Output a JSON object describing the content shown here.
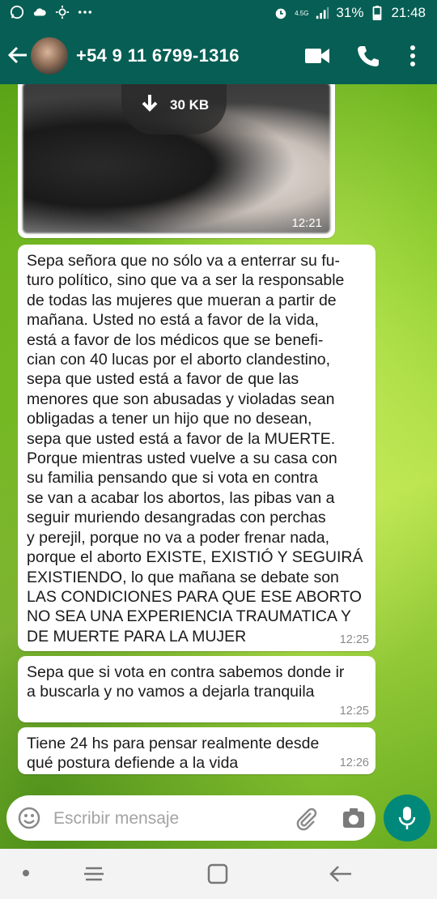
{
  "status_bar": {
    "network_label": "4.5G",
    "battery": "31%",
    "time": "21:48",
    "icons": [
      "whatsapp-icon",
      "cloud-icon",
      "weather-icon",
      "more-dots-icon",
      "alarm-icon",
      "signal-icon",
      "battery-icon"
    ]
  },
  "header": {
    "contact_name": "+54 9 11 6799-1316",
    "colors": {
      "bar": "#075e54"
    }
  },
  "messages": [
    {
      "type": "image",
      "download_size": "30 KB",
      "time": "12:21"
    },
    {
      "type": "text",
      "text": "Sepa señora que no sólo va a enterrar su fu-\nturo político, sino que va a ser la responsable\nde todas las mujeres que mueran a partir de\nmañana. Usted no está a favor de la vida,\nestá a favor de los médicos que se benefi-\ncian con 40 lucas por el aborto clandestino,\nsepa que usted está a favor de que las\nmenores que son abusadas y violadas sean\nobligadas a tener un hijo que no desean,\nsepa que usted está a favor de la MUERTE.\nPorque mientras usted vuelve a su casa con\nsu familia pensando que si vota en contra\nse van a acabar los abortos, las pibas van a\nseguir muriendo desangradas con perchas\ny perejil, porque no va a poder frenar nada,\nporque el aborto EXISTE, EXISTIÓ Y SEGUIRÁ\nEXISTIENDO, lo que mañana se debate son\nLAS CONDICIONES PARA QUE ESE ABORTO\nNO SEA UNA EXPERIENCIA TRAUMATICA Y\nDE MUERTE PARA LA MUJER",
      "time": "12:25"
    },
    {
      "type": "text",
      "text": "Sepa que si vota en contra sabemos donde ir\na buscarla y no vamos a dejarla tranquila",
      "time": "12:25"
    },
    {
      "type": "text",
      "text": "Tiene 24 hs para pensar realmente desde\nqué postura defiende a la vida",
      "time": "12:26"
    }
  ],
  "composer": {
    "placeholder": "Escribir mensaje",
    "colors": {
      "send_button": "#00897b"
    }
  }
}
